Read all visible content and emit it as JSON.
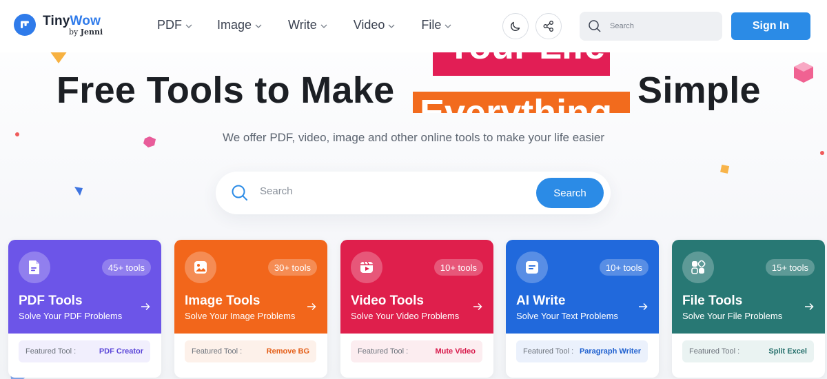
{
  "brand": {
    "name_part1": "Tiny",
    "name_part2": "Wow",
    "by": "by",
    "by_name": "Jenni"
  },
  "nav": [
    {
      "label": "PDF"
    },
    {
      "label": "Image"
    },
    {
      "label": "Write"
    },
    {
      "label": "Video"
    },
    {
      "label": "File"
    }
  ],
  "header": {
    "search_placeholder": "Search",
    "signin_label": "Sign In"
  },
  "hero": {
    "title_left": "Free Tools to Make",
    "title_right": "Simple",
    "rotating_top": "Your Life",
    "rotating_bottom": "Everything",
    "subtitle": "We offer PDF, video, image and other online tools to make your life easier",
    "search_placeholder": "Search",
    "search_button": "Search"
  },
  "cards": [
    {
      "title": "PDF Tools",
      "desc": "Solve Your PDF Problems",
      "count": "45+ tools",
      "feat_label": "Featured Tool :",
      "feat_value": "PDF Creator",
      "color": "#6c55e8",
      "feat_bg": "#f1effd",
      "feat_color": "#5a45d8"
    },
    {
      "title": "Image Tools",
      "desc": "Solve Your Image Problems",
      "count": "30+ tools",
      "feat_label": "Featured Tool :",
      "feat_value": "Remove BG",
      "color": "#f2661b",
      "feat_bg": "#fdf1ea",
      "feat_color": "#e4601a"
    },
    {
      "title": "Video Tools",
      "desc": "Solve Your Video Problems",
      "count": "10+ tools",
      "feat_label": "Featured Tool :",
      "feat_value": "Mute Video",
      "color": "#df1f4c",
      "feat_bg": "#fcedf0",
      "feat_color": "#d8184a"
    },
    {
      "title": "AI Write",
      "desc": "Solve Your Text Problems",
      "count": "10+ tools",
      "feat_label": "Featured Tool :",
      "feat_value": "Paragraph Writer",
      "color": "#2169dc",
      "feat_bg": "#ebf1fc",
      "feat_color": "#1d5fcf"
    },
    {
      "title": "File Tools",
      "desc": "Solve Your File Problems",
      "count": "15+ tools",
      "feat_label": "Featured Tool :",
      "feat_value": "Split Excel",
      "color": "#287874",
      "feat_bg": "#eaf3f2",
      "feat_color": "#236e6a"
    }
  ],
  "colors": {
    "accent": "#2b8be6",
    "rotating_top_bg": "#e21e55",
    "rotating_bottom_bg": "#f26b1d"
  },
  "icons": {
    "logo": "tinywow-logo-icon",
    "theme": "moon-icon",
    "share": "share-icon",
    "search": "search-icon",
    "card_pdf": "pdf-file-icon",
    "card_image": "image-icon",
    "card_video": "video-icon",
    "card_write": "text-doc-icon",
    "card_file": "grid-file-icon",
    "arrow": "arrow-right-icon"
  }
}
